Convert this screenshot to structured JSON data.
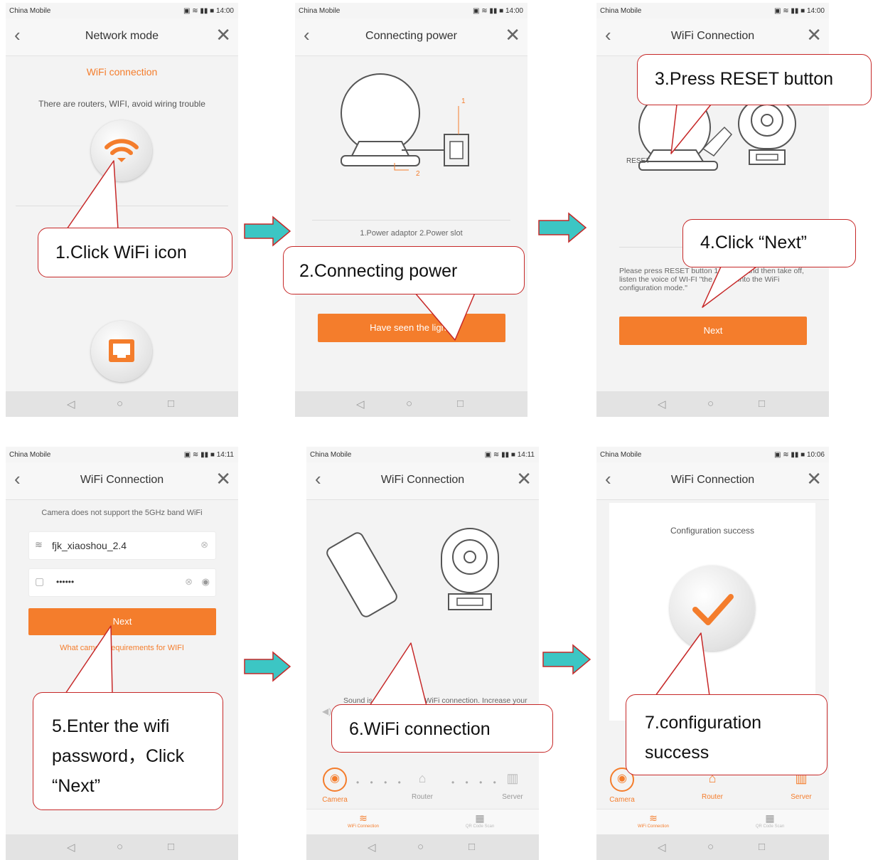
{
  "screens": [
    {
      "carrier": "China Mobile",
      "time": "14:00",
      "title": "Network mode",
      "heading": "WiFi connection",
      "description": "There are routers, WIFI, avoid wiring trouble"
    },
    {
      "carrier": "China Mobile",
      "time": "14:00",
      "title": "Connecting power",
      "label1": "1",
      "label2": "2",
      "caption": "1.Power adaptor 2.Power slot",
      "button": "Have seen the lights"
    },
    {
      "carrier": "China Mobile",
      "time": "14:00",
      "title": "WiFi Connection",
      "reset_label": "RESET",
      "instruction": "Please press RESET button 1 second and then take off, listen the voice of WI-FI \"the device into the WiFi configuration mode.\"",
      "button": "Next"
    },
    {
      "carrier": "China Mobile",
      "time": "14:11",
      "title": "WiFi Connection",
      "notice": "Camera does not support the 5GHz band WiFi",
      "ssid": "fjk_xiaoshou_2.4",
      "password": "••••••",
      "button": "Next",
      "link": "What camera requirements for WIFI"
    },
    {
      "carrier": "China Mobile",
      "time": "14:11",
      "title": "WiFi Connection",
      "sound_text": "Sound is needed for the WiFi connection. Increase your phone volume and place the phone speaker near the camera's mic",
      "steps": [
        "Camera",
        "Router",
        "Server"
      ],
      "tabs": [
        "WiFi Connection",
        "QR Code Scan"
      ]
    },
    {
      "carrier": "China Mobile",
      "time": "10:06",
      "title": "WiFi Connection",
      "success": "Configuration success",
      "steps": [
        "Camera",
        "Router",
        "Server"
      ],
      "tabs": [
        "WiFi Connection",
        "QR Code Scan"
      ]
    }
  ],
  "callouts": {
    "c1": "1.Click WiFi icon",
    "c2": "2.Connecting power",
    "c3": "3.Press RESET button",
    "c4": "4.Click “Next”",
    "c5": "5.Enter the wifi password，Click “Next”",
    "c6": "6.WiFi connection",
    "c7": "7.configuration success"
  },
  "colors": {
    "accent": "#f47d2c",
    "callout_border": "#c62828",
    "flow_arrow": "#3cc6c4"
  }
}
